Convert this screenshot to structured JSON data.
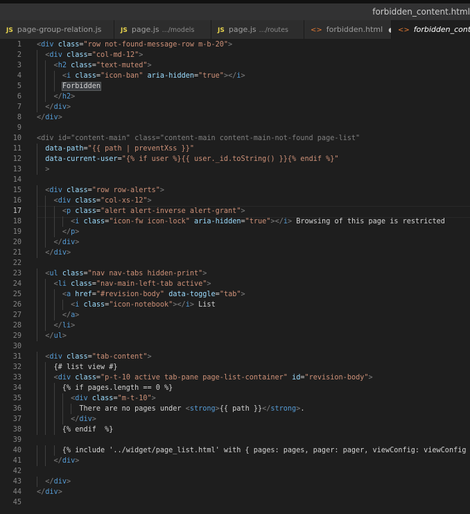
{
  "window": {
    "title": "forbidden_content.html"
  },
  "tabs": [
    {
      "label": "page-group-relation.js",
      "icon": "js-icon",
      "path": "",
      "active": false,
      "dirty": false
    },
    {
      "label": "page.js",
      "icon": "js-icon",
      "path": ".../models",
      "active": false,
      "dirty": false
    },
    {
      "label": "page.js",
      "icon": "js-icon",
      "path": ".../routes",
      "active": false,
      "dirty": false
    },
    {
      "label": "forbidden.html",
      "icon": "html-icon",
      "path": "",
      "active": false,
      "dirty": true
    },
    {
      "label": "forbidden_content.html",
      "icon": "html-icon",
      "path": "",
      "active": true,
      "dirty": false
    }
  ],
  "editor": {
    "current_line": 17,
    "highlight_word": "Forbidden",
    "lines": [
      "<div class=\"row not-found-message-row m-b-20\">",
      "  <div class=\"col-md-12\">",
      "    <h2 class=\"text-muted\">",
      "      <i class=\"icon-ban\" aria-hidden=\"true\"></i>",
      "      Forbidden",
      "    </h2>",
      "  </div>",
      "</div>",
      "",
      "<div id=\"content-main\" class=\"content-main content-main-not-found page-list\"",
      "  data-path=\"{{ path | preventXss }}\"",
      "  data-current-user=\"{% if user %}{{ user._id.toString() }}{% endif %}\"",
      "  >",
      "",
      "  <div class=\"row row-alerts\">",
      "    <div class=\"col-xs-12\">",
      "      <p class=\"alert alert-inverse alert-grant\">",
      "        <i class=\"icon-fw icon-lock\" aria-hidden=\"true\"></i> Browsing of this page is restricted",
      "      </p>",
      "    </div>",
      "  </div>",
      "",
      "  <ul class=\"nav nav-tabs hidden-print\">",
      "    <li class=\"nav-main-left-tab active\">",
      "      <a href=\"#revision-body\" data-toggle=\"tab\">",
      "        <i class=\"icon-notebook\"></i> List",
      "      </a>",
      "    </li>",
      "  </ul>",
      "",
      "  <div class=\"tab-content\">",
      "    {# list view #}",
      "    <div class=\"p-t-10 active tab-pane page-list-container\" id=\"revision-body\">",
      "      {% if pages.length == 0 %}",
      "        <div class=\"m-t-10\">",
      "          There are no pages under <strong>{{ path }}</strong>.",
      "        </div>",
      "      {% endif  %}",
      "",
      "      {% include '../widget/page_list.html' with { pages: pages, pager: pager, viewConfig: viewConfig } %}",
      "    </div>",
      "",
      "  </div>",
      "</div>",
      ""
    ]
  },
  "colors": {
    "tag": "#569cd6",
    "attribute": "#9cdcfe",
    "string": "#ce9178",
    "text": "#d4d4d4",
    "line_number": "#858585",
    "background": "#1e1e1e"
  }
}
